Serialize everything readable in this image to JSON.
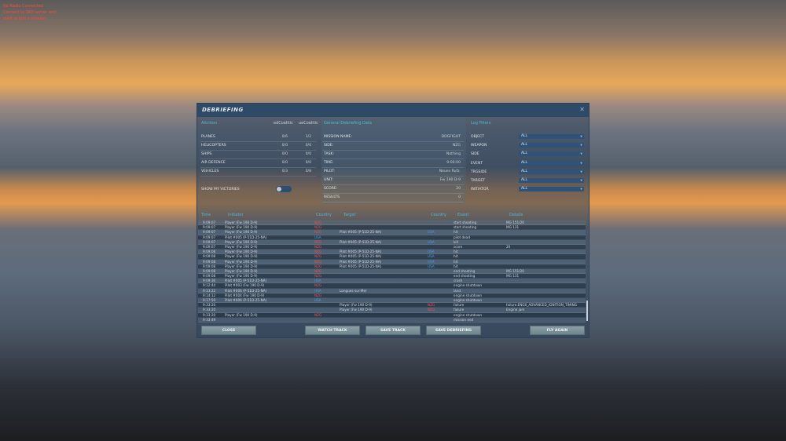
{
  "hud": {
    "line1": "No Radio Connected",
    "line2": "Connect to SRS server and",
    "line3": "start or join a mission"
  },
  "dialog": {
    "title": "DEBRIEFING"
  },
  "attrition": {
    "title": "Attrition",
    "col1": "edCoalitic",
    "col2": "ueCoalitic",
    "rows": [
      {
        "label": "PLANES",
        "a": "0/6",
        "b": "1/2"
      },
      {
        "label": "HELICOPTERS",
        "a": "0/0",
        "b": "0/0"
      },
      {
        "label": "SHIPS",
        "a": "0/0",
        "b": "0/0"
      },
      {
        "label": "AIR DEFENCE",
        "a": "0/0",
        "b": "0/0"
      },
      {
        "label": "VEHICLES",
        "a": "0/3",
        "b": "0/8"
      }
    ],
    "show_victories": "SHOW MY VICTORIES",
    "show_victories_on": false
  },
  "general": {
    "title": "General Debriefing Data",
    "rows": [
      {
        "label": "MISSION NAME:",
        "value": "DOGFIGHT"
      },
      {
        "label": "SIDE:",
        "value": "NZG"
      },
      {
        "label": "TASK:",
        "value": "Nothing"
      },
      {
        "label": "TIME:",
        "value": "9:00:00"
      },
      {
        "label": "PILOT:",
        "value": "Neues Rufz."
      },
      {
        "label": "UNIT:",
        "value": "Fw 190 D-9"
      },
      {
        "label": "SCORE:",
        "value": "20"
      },
      {
        "label": "RESULTS",
        "value": "0"
      }
    ]
  },
  "filters": {
    "title": "Log Filters",
    "rows": [
      {
        "label": "OBJECT",
        "value": "ALL"
      },
      {
        "label": "WEAPON",
        "value": "ALL"
      },
      {
        "label": "SIDE",
        "value": "ALL"
      },
      {
        "label": "EVENT",
        "value": "ALL"
      },
      {
        "label": "TRGSIDE",
        "value": "ALL"
      },
      {
        "label": "TARGET",
        "value": "ALL"
      },
      {
        "label": "INITIATOR",
        "value": "ALL"
      }
    ]
  },
  "log": {
    "headers": {
      "time": "Time",
      "initiator": "Initiator",
      "country": "Country",
      "target": "Target",
      "country2": "Country",
      "event": "Event",
      "details": "Details"
    },
    "rows": [
      {
        "time": "9:09:07",
        "ini": "Player (Fw 190 D-9)",
        "c1": "NZG",
        "tgt": "",
        "c2": "",
        "ev": "start shooting",
        "det": "MG 151/20"
      },
      {
        "time": "9:09:07",
        "ini": "Player (Fw 190 D-9)",
        "c1": "NZG",
        "tgt": "",
        "c2": "",
        "ev": "start shooting",
        "det": "MG 131"
      },
      {
        "time": "9:09:07",
        "ini": "Player (Fw 190 D-9)",
        "c1": "NZG",
        "tgt": "Pilot #005 (P-51D-25-NA)",
        "c2": "USA",
        "ev": "hit",
        "det": ""
      },
      {
        "time": "9:09:07",
        "ini": "Pilot #005 (P-51D-25-NA)",
        "c1": "USA",
        "tgt": "",
        "c2": "",
        "ev": "pilot dead",
        "det": ""
      },
      {
        "time": "9:09:07",
        "ini": "Player (Fw 190 D-9)",
        "c1": "NZG",
        "tgt": "Pilot #005 (P-51D-25-NA)",
        "c2": "USA",
        "ev": "kill",
        "det": ""
      },
      {
        "time": "9:09:07",
        "ini": "Player (Fw 190 D-9)",
        "c1": "NZG",
        "tgt": "",
        "c2": "",
        "ev": "score",
        "det": "20"
      },
      {
        "time": "9:09:08",
        "ini": "Player (Fw 190 D-9)",
        "c1": "NZG",
        "tgt": "Pilot #005 (P-51D-25-NA)",
        "c2": "USA",
        "ev": "hit",
        "det": ""
      },
      {
        "time": "9:09:08",
        "ini": "Player (Fw 190 D-9)",
        "c1": "NZG",
        "tgt": "Pilot #005 (P-51D-25-NA)",
        "c2": "USA",
        "ev": "hit",
        "det": ""
      },
      {
        "time": "9:09:08",
        "ini": "Player (Fw 190 D-9)",
        "c1": "NZG",
        "tgt": "Pilot #005 (P-51D-25-NA)",
        "c2": "USA",
        "ev": "hit",
        "det": ""
      },
      {
        "time": "9:09:08",
        "ini": "Player (Fw 190 D-9)",
        "c1": "NZG",
        "tgt": "Pilot #005 (P-51D-25-NA)",
        "c2": "USA",
        "ev": "hit",
        "det": ""
      },
      {
        "time": "9:09:08",
        "ini": "Player (Fw 190 D-9)",
        "c1": "NZG",
        "tgt": "",
        "c2": "",
        "ev": "end shooting",
        "det": "MG 151/20"
      },
      {
        "time": "9:09:08",
        "ini": "Player (Fw 190 D-9)",
        "c1": "NZG",
        "tgt": "",
        "c2": "",
        "ev": "end shooting",
        "det": "MG 131"
      },
      {
        "time": "9:09:30",
        "ini": "Pilot #005 (P-51D-25-NA)",
        "c1": "USA",
        "tgt": "",
        "c2": "",
        "ev": "crash",
        "det": ""
      },
      {
        "time": "9:12:44",
        "ini": "Pilot #003 (Fw 190 D-9)",
        "c1": "NZG",
        "tgt": "",
        "c2": "",
        "ev": "engine shutdown",
        "det": ""
      },
      {
        "time": "9:13:22",
        "ini": "Pilot #006 (P-51D-25-NA)",
        "c1": "USA",
        "tgt": "Longues-sur-Mer",
        "c2": "",
        "ev": "land",
        "det": ""
      },
      {
        "time": "9:14:12",
        "ini": "Pilot #004 (Fw 190 D-9)",
        "c1": "NZG",
        "tgt": "",
        "c2": "",
        "ev": "engine shutdown",
        "det": ""
      },
      {
        "time": "9:17:50",
        "ini": "Pilot #006 (P-51D-25-NA)",
        "c1": "USA",
        "tgt": "",
        "c2": "",
        "ev": "engine shutdown",
        "det": ""
      },
      {
        "time": "9:33:20",
        "ini": "",
        "c1": "",
        "tgt": "Player (Fw 190 D-9)",
        "c2": "NZG",
        "ev": "failure",
        "det": "failure.ENG0_ADVANCED_IGNITION_TIMING"
      },
      {
        "time": "9:33:20",
        "ini": "",
        "c1": "",
        "tgt": "Player (Fw 190 D-9)",
        "c2": "NZG",
        "ev": "failure",
        "det": "Engine jam"
      },
      {
        "time": "9:33:20",
        "ini": "Player (Fw 190 D-9)",
        "c1": "NZG",
        "tgt": "",
        "c2": "",
        "ev": "engine shutdown",
        "det": ""
      },
      {
        "time": "9:33:49",
        "ini": "",
        "c1": "",
        "tgt": "",
        "c2": "",
        "ev": "mission end",
        "det": ""
      }
    ]
  },
  "buttons": {
    "close": "CLOSE",
    "watch_track": "WATCH TRACK",
    "save_track": "SAVE TRACK",
    "save_debriefing": "SAVE DEBRIEFING",
    "fly_again": "FLY AGAIN"
  }
}
